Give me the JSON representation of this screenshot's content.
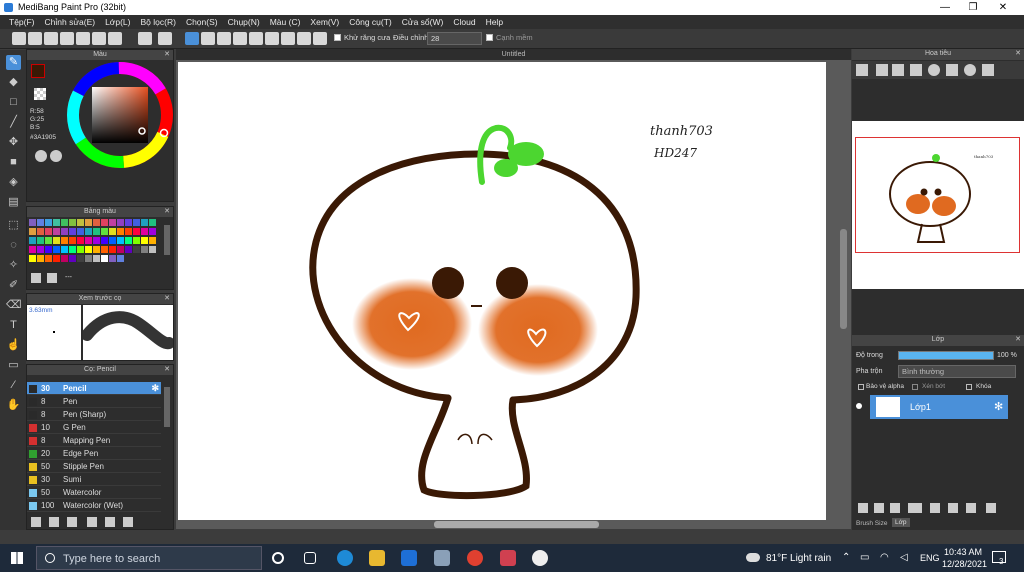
{
  "window": {
    "title": "MediBang Paint Pro (32bit)"
  },
  "menu": [
    "Tệp(F)",
    "Chỉnh sửa(E)",
    "Lớp(L)",
    "Bộ lọc(R)",
    "Chọn(S)",
    "Chụp(N)",
    "Màu (C)",
    "Xem(V)",
    "Công cụ(T)",
    "Cửa sổ(W)",
    "Cloud",
    "Help"
  ],
  "toolbar": {
    "antialias_label": "Khử răng cưa",
    "adjust_label": "Điều chỉnh",
    "adjust_value": "28",
    "edge_label": "Cạnh mềm"
  },
  "color_panel": {
    "title": "Màu",
    "r": "R:58",
    "g": "G:25",
    "b": "B:5",
    "hex": "#3A1905"
  },
  "palette_panel": {
    "title": "Bảng màu",
    "ellipsis": "---"
  },
  "brush_preview": {
    "title": "Xem trước cọ",
    "size": "3.63mm"
  },
  "brush_panel": {
    "title": "Cọ: Pencil",
    "items": [
      {
        "size": "30",
        "name": "Pencil",
        "color": "#2a2a2a"
      },
      {
        "size": "8",
        "name": "Pen",
        "color": "#2a2a2a"
      },
      {
        "size": "8",
        "name": "Pen (Sharp)",
        "color": "#2a2a2a"
      },
      {
        "size": "10",
        "name": "G Pen",
        "color": "#d43030"
      },
      {
        "size": "8",
        "name": "Mapping Pen",
        "color": "#d43030"
      },
      {
        "size": "20",
        "name": "Edge Pen",
        "color": "#30a030"
      },
      {
        "size": "50",
        "name": "Stipple Pen",
        "color": "#e8c020"
      },
      {
        "size": "30",
        "name": "Sumi",
        "color": "#e8c020"
      },
      {
        "size": "50",
        "name": "Watercolor",
        "color": "#7ac8f0"
      },
      {
        "size": "100",
        "name": "Watercolor (Wet)",
        "color": "#7ac8f0"
      }
    ]
  },
  "canvas": {
    "title": "Untitled",
    "signature_line1": "thanh703",
    "signature_line2": "HD247"
  },
  "navigator": {
    "title": "Hoa tiêu"
  },
  "layer_panel": {
    "title": "Lớp",
    "opacity_label": "Độ trong",
    "opacity_value": "100 %",
    "opacity": 1.0,
    "blend_label": "Pha trộn",
    "blend_value": "Bình thường",
    "protect_alpha": "Bảo vệ alpha",
    "clip": "Xén bớt",
    "lock": "Khóa",
    "layer_name": "Lớp1"
  },
  "bottom_tabs": {
    "brush_size": "Brush Size",
    "layer": "Lớp"
  },
  "taskbar": {
    "search_placeholder": "Type here to search",
    "weather": "81°F  Light rain",
    "lang": "ENG",
    "time": "10:43 AM",
    "date": "12/28/2021",
    "notif": "3"
  },
  "colors": {
    "primary": "#3A1905",
    "blush": "#E06A20",
    "sprout": "#4CD630"
  }
}
